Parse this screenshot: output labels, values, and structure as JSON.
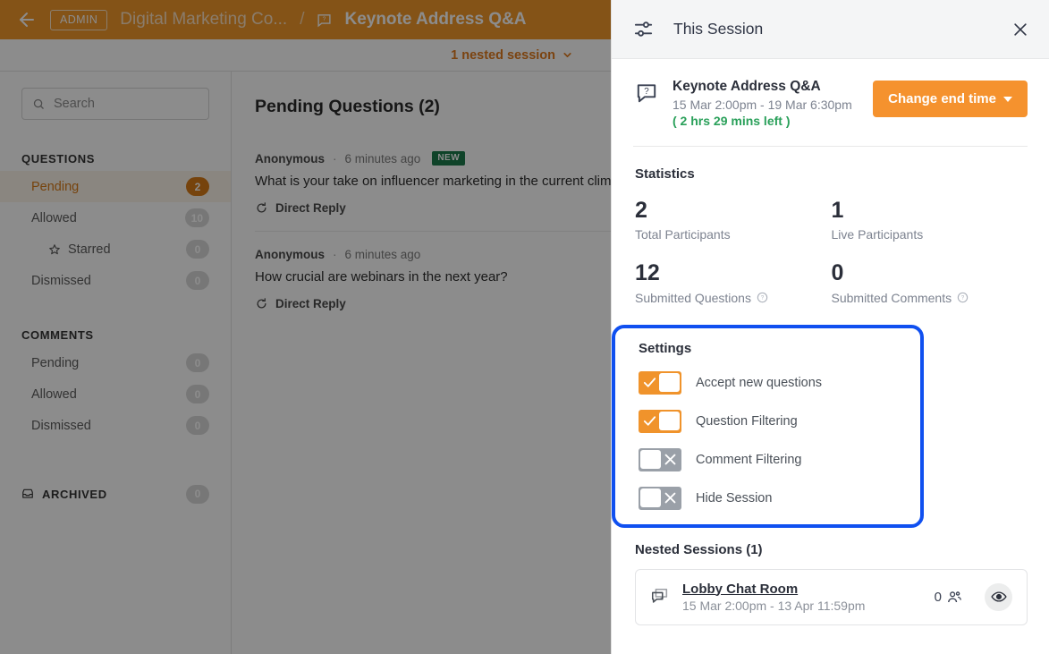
{
  "topbar": {
    "back_icon": "back-arrow-icon",
    "admin_badge": "ADMIN",
    "breadcrumb_parent": "Digital Marketing Co...",
    "breadcrumb_separator": "/",
    "breadcrumb_icon": "qa-bubble-icon",
    "breadcrumb_current": "Keynote Address Q&A",
    "accent_color": "#f0972b"
  },
  "nested_bar": {
    "label": "1 nested session",
    "chevron_icon": "chevron-down-icon",
    "color": "#e07b1e"
  },
  "sidebar": {
    "search_placeholder": "Search",
    "search_icon": "search-icon",
    "sections": [
      {
        "title": "QUESTIONS",
        "items": [
          {
            "label": "Pending",
            "count": "2",
            "active": true,
            "sub": false
          },
          {
            "label": "Allowed",
            "count": "10",
            "active": false,
            "sub": false
          },
          {
            "label": "Starred",
            "count": "0",
            "active": false,
            "sub": true,
            "icon": "star-icon"
          },
          {
            "label": "Dismissed",
            "count": "0",
            "active": false,
            "sub": false
          }
        ]
      },
      {
        "title": "COMMENTS",
        "items": [
          {
            "label": "Pending",
            "count": "0",
            "active": false,
            "sub": false
          },
          {
            "label": "Allowed",
            "count": "0",
            "active": false,
            "sub": false
          },
          {
            "label": "Dismissed",
            "count": "0",
            "active": false,
            "sub": false
          }
        ]
      }
    ],
    "archived": {
      "label": "ARCHIVED",
      "count": "0",
      "icon": "archive-icon"
    }
  },
  "main": {
    "title": "Pending Questions (2)",
    "questions": [
      {
        "author": "Anonymous",
        "dot": "·",
        "time": "6 minutes ago",
        "badge": "NEW",
        "text": "What is your take on influencer marketing in the current climate?",
        "reply_label": "Direct Reply",
        "reply_icon": "direct-reply-icon"
      },
      {
        "author": "Anonymous",
        "dot": "·",
        "time": "6 minutes ago",
        "badge": "",
        "text": "How crucial are webinars in the next year?",
        "reply_label": "Direct Reply",
        "reply_icon": "direct-reply-icon"
      }
    ]
  },
  "panel": {
    "header": {
      "title": "This Session",
      "tune_icon": "sliders-icon",
      "close_icon": "close-icon"
    },
    "session": {
      "icon": "qa-bubble-icon",
      "name": "Keynote Address Q&A",
      "time_range": "15 Mar 2:00pm - 19 Mar 6:30pm",
      "time_left": "( 2 hrs 29 mins left )",
      "button_label": "Change end time",
      "button_color": "#f5922e"
    },
    "statistics": {
      "title": "Statistics",
      "items": [
        {
          "value": "2",
          "label": "Total Participants",
          "help": false
        },
        {
          "value": "1",
          "label": "Live Participants",
          "help": false
        },
        {
          "value": "12",
          "label": "Submitted Questions",
          "help": true
        },
        {
          "value": "0",
          "label": "Submitted Comments",
          "help": true
        }
      ]
    },
    "settings": {
      "title": "Settings",
      "highlight_color": "#1050f0",
      "toggles": [
        {
          "label": "Accept new questions",
          "on": true
        },
        {
          "label": "Question Filtering",
          "on": true
        },
        {
          "label": "Comment Filtering",
          "on": false
        },
        {
          "label": "Hide Session",
          "on": false
        }
      ]
    },
    "nested_sessions": {
      "title": "Nested Sessions (1)",
      "items": [
        {
          "icon": "chat-bubbles-icon",
          "name": "Lobby Chat Room",
          "time_range": "15 Mar 2:00pm - 13 Apr 11:59pm",
          "participant_count": "0",
          "people_icon": "people-icon",
          "eye_icon": "eye-icon"
        }
      ]
    }
  }
}
